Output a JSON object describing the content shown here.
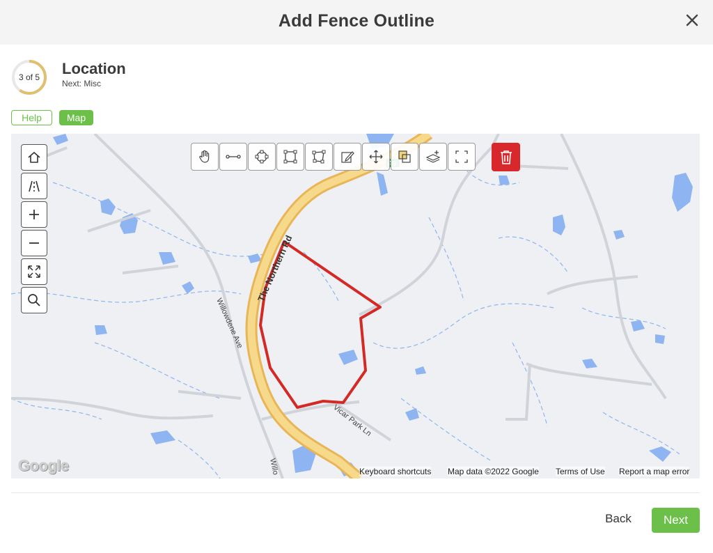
{
  "header": {
    "title": "Add Fence Outline",
    "close_icon": "close-icon"
  },
  "step": {
    "progress_text": "3 of 5",
    "current": 3,
    "total": 5,
    "title": "Location",
    "next": "Next: Misc"
  },
  "tabs": {
    "help": "Help",
    "map": "Map"
  },
  "map": {
    "side_controls": [
      "home-icon",
      "road-icon",
      "zoom-in-icon",
      "zoom-out-icon",
      "fullscreen-expand-icon",
      "search-icon"
    ],
    "toolbar": [
      "hand-pan-icon",
      "line-icon",
      "circle-icon",
      "rectangle-icon",
      "polygon-icon",
      "edit-pencil-icon",
      "move-icon",
      "duplicate-icon",
      "layers-add-icon",
      "select-area-icon"
    ],
    "delete_icon": "trash-icon",
    "labels": {
      "road_main": "The Northern Rd",
      "road_shield": "A9",
      "street_1": "Willowdene Ave",
      "street_2": "Willo",
      "street_3": "Vicar Park Ln"
    },
    "google": "Google",
    "attribution": {
      "shortcuts": "Keyboard shortcuts",
      "data": "Map data ©2022 Google",
      "terms": "Terms of Use",
      "report": "Report a map error"
    },
    "colors": {
      "fence": "#d42a26",
      "water": "#8fb4f2",
      "highway": "#f2c76a"
    }
  },
  "footer": {
    "back": "Back",
    "next": "Next"
  },
  "colors": {
    "accent": "#6cc04a",
    "danger": "#d8282c"
  }
}
